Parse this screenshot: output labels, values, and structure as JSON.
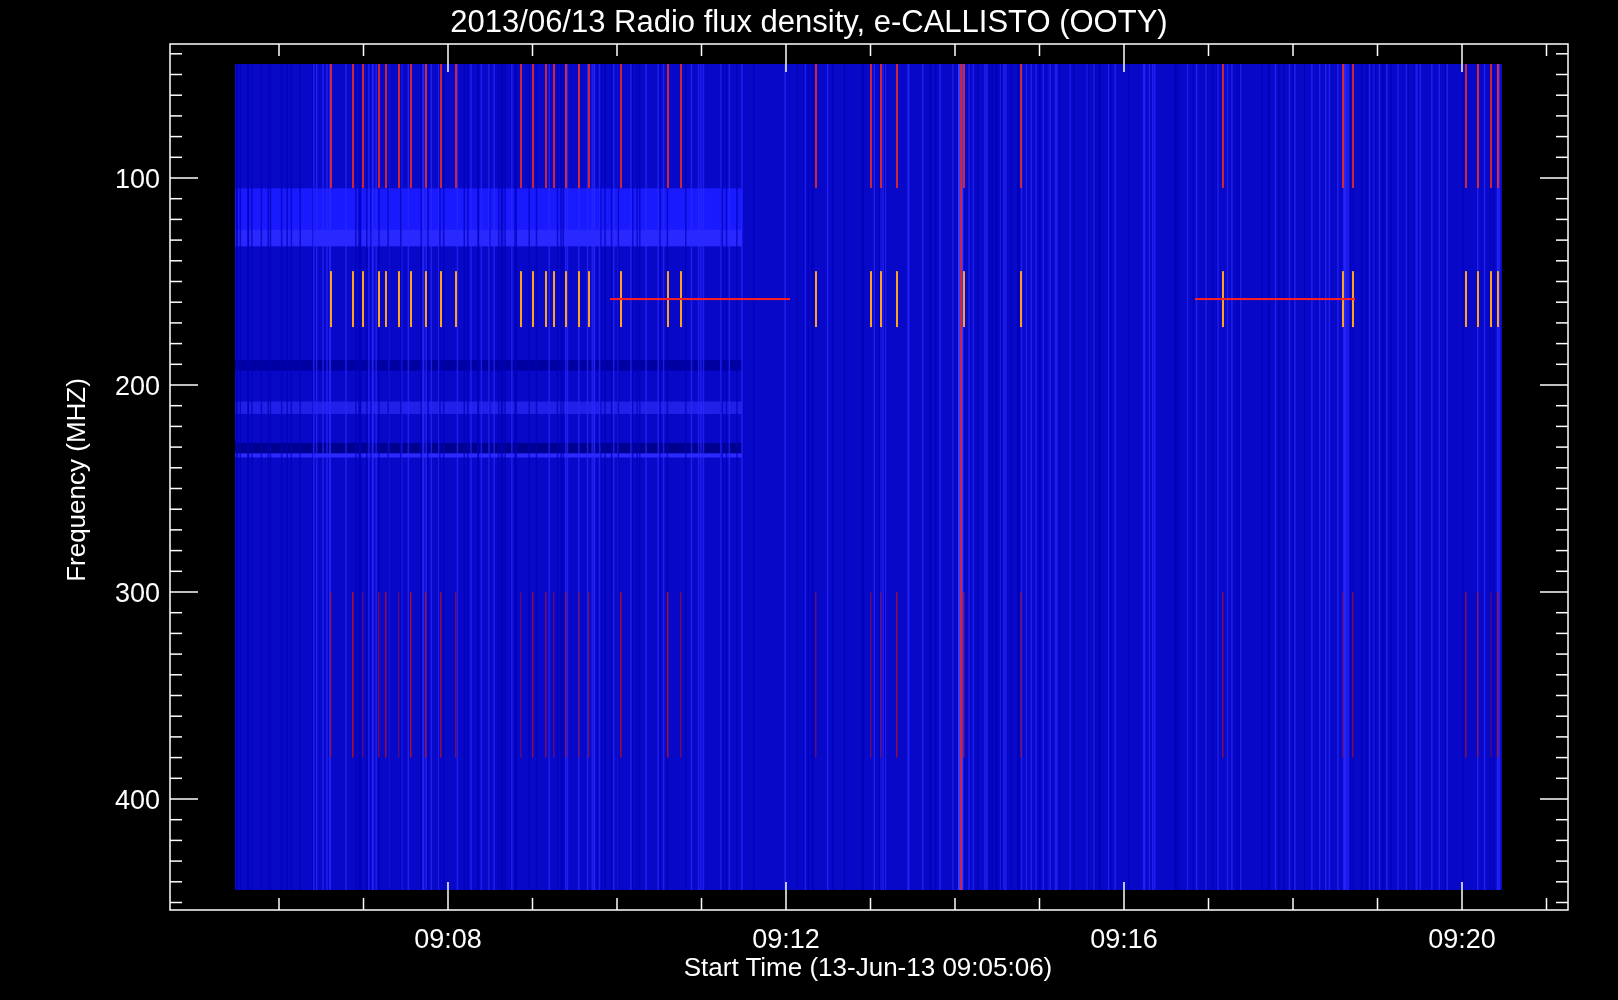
{
  "plot": {
    "title": "2013/06/13  Radio flux density, e-CALLISTO (OOTY)",
    "xlabel": "Start Time (13-Jun-13 09:05:06)",
    "ylabel": "Frequency (MHZ)",
    "yticks": [
      "100",
      "200",
      "300",
      "400"
    ],
    "xticks": [
      "09:08",
      "09:12",
      "09:16",
      "09:20"
    ]
  }
}
